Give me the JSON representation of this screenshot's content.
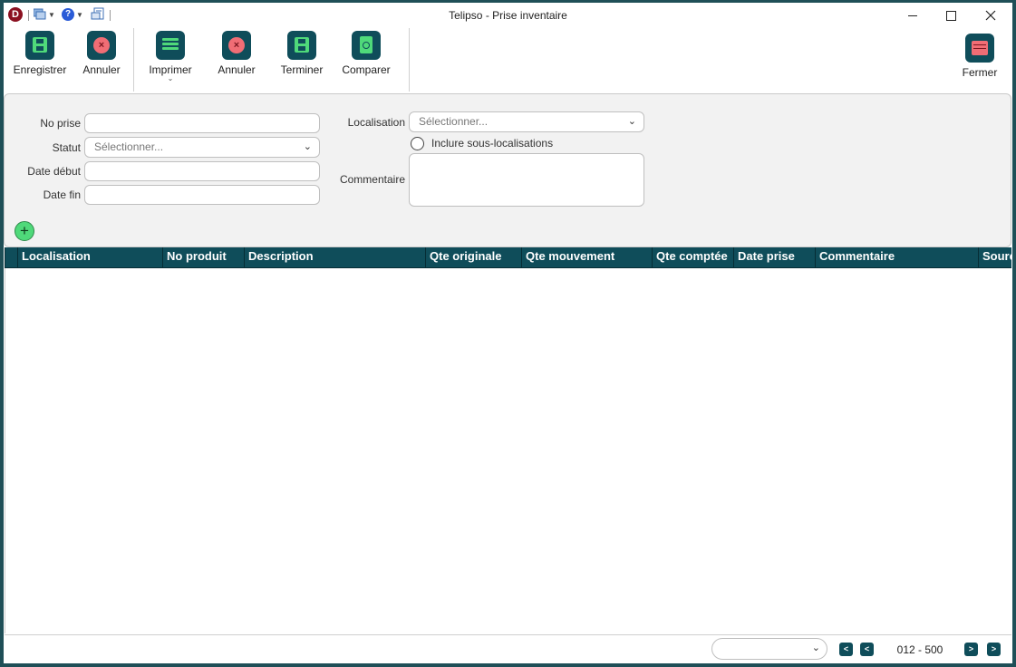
{
  "window": {
    "title": "Telipso - Prise inventaire",
    "app_logo_letter": "D"
  },
  "quick_access": [
    {
      "icon": "window-list-icon"
    },
    {
      "icon": "help-icon",
      "glyph": "?"
    },
    {
      "icon": "print-preview-icon"
    }
  ],
  "toolbar": {
    "enregistrer_label": "Enregistrer",
    "annuler1_label": "Annuler",
    "imprimer_label": "Imprimer",
    "annuler2_label": "Annuler",
    "terminer_label": "Terminer",
    "comparer_label": "Comparer",
    "fermer_label": "Fermer",
    "accent_color": "#0f4d5a",
    "save_color": "#4fd97a",
    "cancel_color": "#f06d75"
  },
  "form": {
    "no_prise": {
      "label": "No prise",
      "value": ""
    },
    "statut": {
      "label": "Statut",
      "placeholder": "Sélectionner..."
    },
    "date_debut": {
      "label": "Date début",
      "value": ""
    },
    "date_fin": {
      "label": "Date fin",
      "value": ""
    },
    "localisation": {
      "label": "Localisation",
      "placeholder": "Sélectionner..."
    },
    "inclure_sous_localisations": {
      "label": "Inclure sous-localisations",
      "checked": false
    },
    "commentaire": {
      "label": "Commentaire",
      "value": ""
    }
  },
  "grid": {
    "columns": [
      "Localisation",
      "No produit",
      "Description",
      "Qte originale",
      "Qte mouvement",
      "Qte comptée",
      "Date prise",
      "Commentaire",
      "Source"
    ],
    "rows": []
  },
  "pagination": {
    "page_info": "012 - 500",
    "page_size_value": ""
  }
}
